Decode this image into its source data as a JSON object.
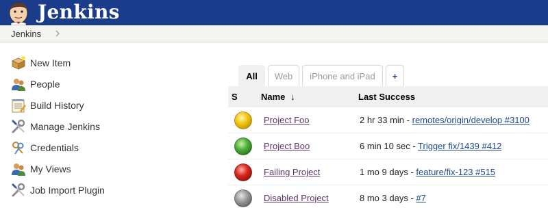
{
  "header": {
    "brand": "Jenkins",
    "logo": "jenkins-butler-logo"
  },
  "breadcrumb": {
    "item": "Jenkins",
    "arrow_icon": "chevron-right-icon"
  },
  "sidebar": {
    "items": [
      {
        "label": "New Item",
        "icon": "new-item-icon"
      },
      {
        "label": "People",
        "icon": "people-icon"
      },
      {
        "label": "Build History",
        "icon": "notepad-icon"
      },
      {
        "label": "Manage Jenkins",
        "icon": "wrench-screwdriver-icon"
      },
      {
        "label": "Credentials",
        "icon": "keys-icon"
      },
      {
        "label": "My Views",
        "icon": "people-icon"
      },
      {
        "label": "Job Import Plugin",
        "icon": "wrench-screwdriver-icon"
      }
    ]
  },
  "tabs": [
    {
      "label": "All",
      "active": true
    },
    {
      "label": "Web",
      "active": false
    },
    {
      "label": "iPhone and iPad",
      "active": false
    },
    {
      "label": "+",
      "active": false
    }
  ],
  "table": {
    "headers": {
      "status": "S",
      "name": "Name",
      "sort_indicator": "↓",
      "last_success": "Last Success"
    },
    "rows": [
      {
        "status_color": "#f1c40f",
        "status": "yellow",
        "name": "Project Foo",
        "time": "2 hr 33 min",
        "separator": " - ",
        "build_link": "remotes/origin/develop #3100"
      },
      {
        "status_color": "#4fae3a",
        "status": "green",
        "name": "Project Boo",
        "time": "6 min 10 sec",
        "separator": " - ",
        "build_link": "Trigger fix/1439 #412"
      },
      {
        "status_color": "#d9261c",
        "status": "red",
        "name": "Failing Project",
        "time": "1 mo 9 days",
        "separator": " - ",
        "build_link": "feature/fix-123 #515"
      },
      {
        "status_color": "#9a9a9a",
        "status": "grey",
        "name": "Disabled Project",
        "time": "8 mo 3 days",
        "separator": " - ",
        "build_link": "#7"
      }
    ]
  }
}
